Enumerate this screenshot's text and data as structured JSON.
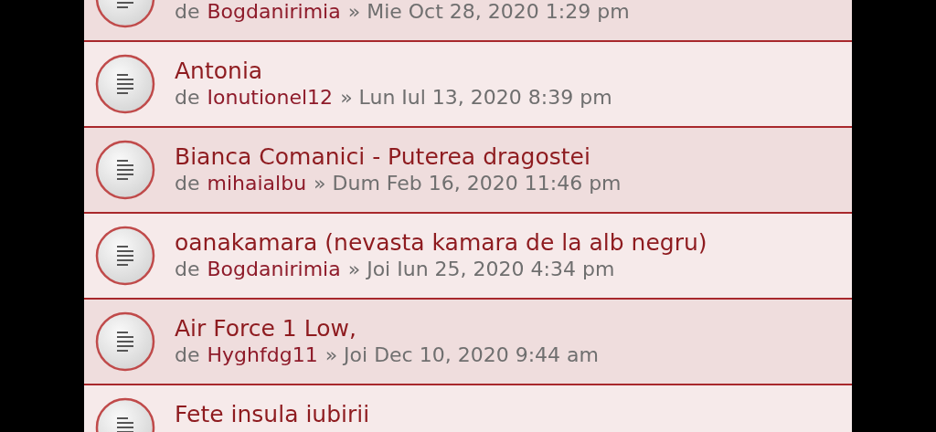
{
  "topics": [
    {
      "author_prefix": "de",
      "author": "Bogdanirimia",
      "separator": "»",
      "date": "Mie Oct 28, 2020 1:29 pm"
    },
    {
      "title": "Antonia",
      "author_prefix": "de",
      "author": "Ionutionel12",
      "separator": "»",
      "date": "Lun Iul 13, 2020 8:39 pm"
    },
    {
      "title": "Bianca Comanici - Puterea dragostei",
      "author_prefix": "de",
      "author": "mihaialbu",
      "separator": "»",
      "date": "Dum Feb 16, 2020 11:46 pm"
    },
    {
      "title": "oanakamara (nevasta kamara de la alb negru)",
      "author_prefix": "de",
      "author": "Bogdanirimia",
      "separator": "»",
      "date": "Joi Iun 25, 2020 4:34 pm"
    },
    {
      "title": "Air Force 1 Low,",
      "author_prefix": "de",
      "author": "Hyghfdg11",
      "separator": "»",
      "date": "Joi Dec 10, 2020 9:44 am"
    },
    {
      "title": "Fete insula iubirii"
    }
  ]
}
